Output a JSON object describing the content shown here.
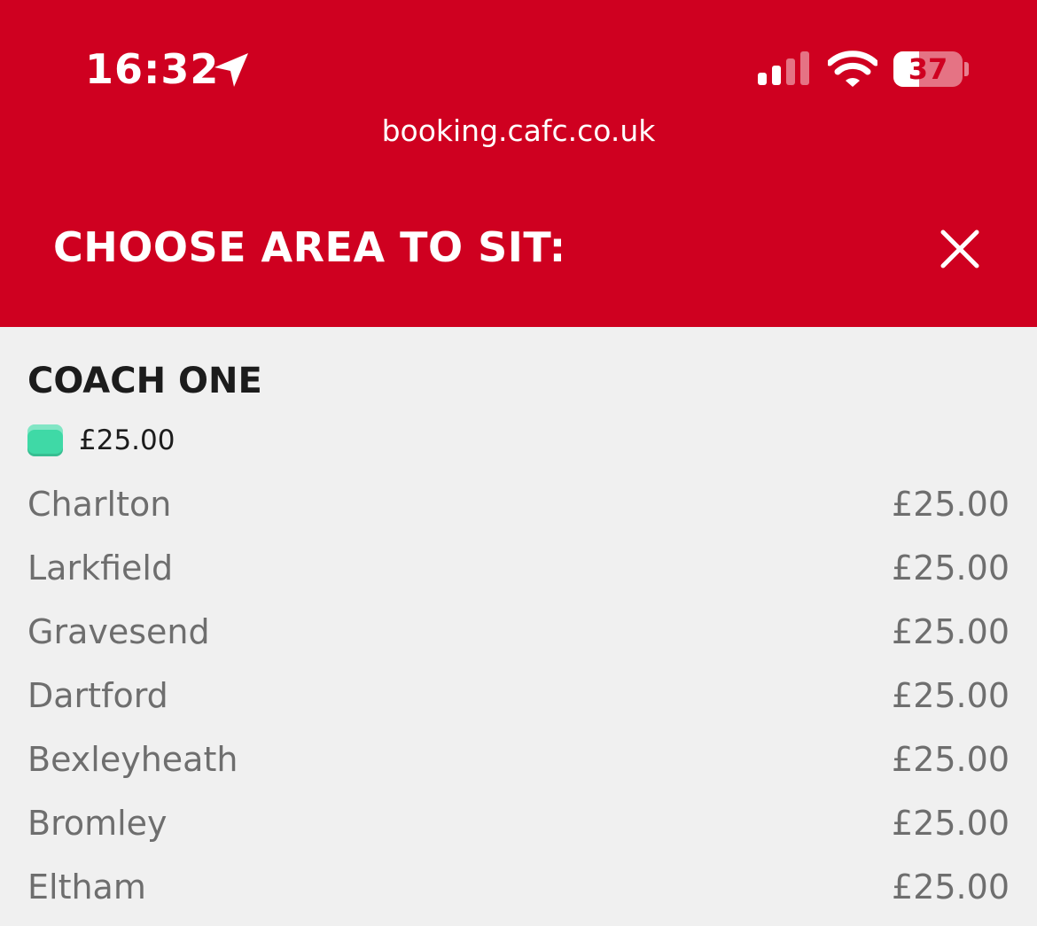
{
  "status_bar": {
    "time": "16:32",
    "battery_level": "37",
    "battery_fraction": 0.37
  },
  "browser": {
    "url": "booking.cafc.co.uk"
  },
  "modal": {
    "title": "CHOOSE AREA TO SIT:",
    "close_icon": "close-icon"
  },
  "section": {
    "title": "COACH ONE",
    "legend_price": "£25.00",
    "legend_color": "#3fd9a6"
  },
  "stops": [
    {
      "name": "Charlton",
      "price": "£25.00"
    },
    {
      "name": "Larkfield",
      "price": "£25.00"
    },
    {
      "name": "Gravesend",
      "price": "£25.00"
    },
    {
      "name": "Dartford",
      "price": "£25.00"
    },
    {
      "name": "Bexleyheath",
      "price": "£25.00"
    },
    {
      "name": "Bromley",
      "price": "£25.00"
    },
    {
      "name": "Eltham",
      "price": "£25.00"
    }
  ],
  "colors": {
    "header_red": "#cf0020",
    "background": "#f0f0f0",
    "muted_text": "#6e6e6e"
  }
}
